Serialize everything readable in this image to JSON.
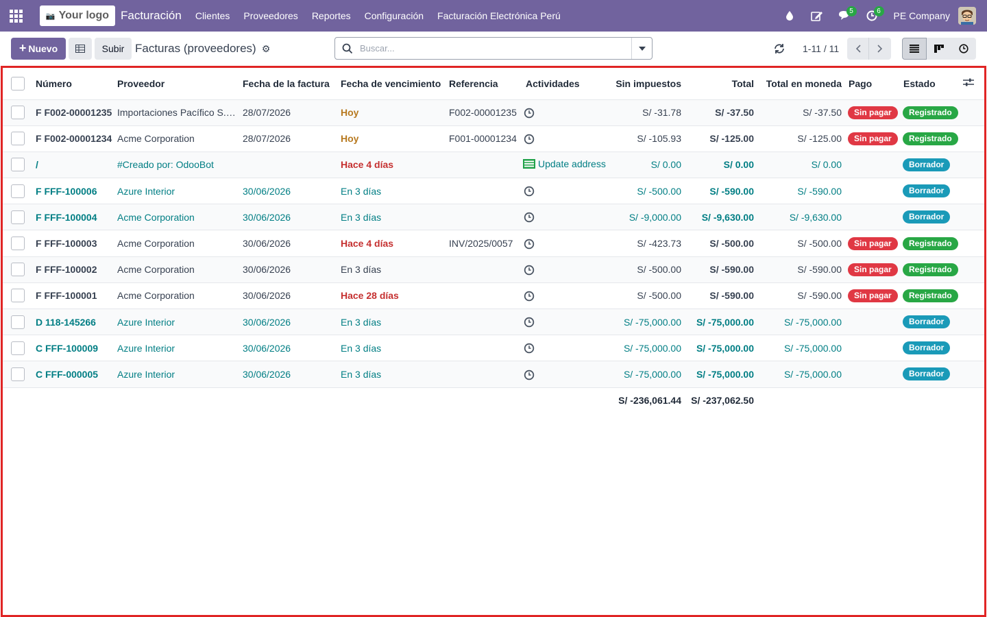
{
  "navbar": {
    "logo_text": "Your logo",
    "app_name": "Facturación",
    "menu": [
      "Clientes",
      "Proveedores",
      "Reportes",
      "Configuración",
      "Facturación Electrónica Perú"
    ],
    "messages_count": "5",
    "activities_count": "6",
    "company": "PE Company"
  },
  "control": {
    "new_label": "Nuevo",
    "upload_label": "Subir",
    "title": "Facturas (proveedores)",
    "search_placeholder": "Buscar...",
    "pager": "1-11 / 11"
  },
  "table": {
    "headers": [
      "Número",
      "Proveedor",
      "Fecha de la factura",
      "Fecha de vencimiento",
      "Referencia",
      "Actividades",
      "Sin impuestos",
      "Total",
      "Total en moneda",
      "Pago",
      "Estado"
    ],
    "rows": [
      {
        "number": "F F002-00001235",
        "partner": "Importaciones Pacífico S.A.C.",
        "date": "28/07/2026",
        "due": "Hoy",
        "due_type": "today",
        "ref": "F002-00001235",
        "activity": "",
        "untaxed": "S/ -31.78",
        "total": "S/ -37.50",
        "total_cur": "S/ -37.50",
        "payment": "Sin pagar",
        "state": "Registrado",
        "link": false
      },
      {
        "number": "F F002-00001234",
        "partner": "Acme Corporation",
        "date": "28/07/2026",
        "due": "Hoy",
        "due_type": "today",
        "ref": "F001-00001234",
        "activity": "",
        "untaxed": "S/ -105.93",
        "total": "S/ -125.00",
        "total_cur": "S/ -125.00",
        "payment": "Sin pagar",
        "state": "Registrado",
        "link": false
      },
      {
        "number": "/",
        "partner": "#Creado por: OdooBot",
        "date": "",
        "due": "Hace 4 días",
        "due_type": "late",
        "ref": "",
        "activity": "Update address",
        "untaxed": "S/ 0.00",
        "total": "S/ 0.00",
        "total_cur": "S/ 0.00",
        "payment": "",
        "state": "Borrador",
        "link": true
      },
      {
        "number": "F FFF-100006",
        "partner": "Azure Interior",
        "date": "30/06/2026",
        "due": "En 3 días",
        "due_type": "future",
        "ref": "",
        "activity": "",
        "untaxed": "S/ -500.00",
        "total": "S/ -590.00",
        "total_cur": "S/ -590.00",
        "payment": "",
        "state": "Borrador",
        "link": true
      },
      {
        "number": "F FFF-100004",
        "partner": "Acme Corporation",
        "date": "30/06/2026",
        "due": "En 3 días",
        "due_type": "future",
        "ref": "",
        "activity": "",
        "untaxed": "S/ -9,000.00",
        "total": "S/ -9,630.00",
        "total_cur": "S/ -9,630.00",
        "payment": "",
        "state": "Borrador",
        "link": true
      },
      {
        "number": "F FFF-100003",
        "partner": "Acme Corporation",
        "date": "30/06/2026",
        "due": "Hace 4 días",
        "due_type": "late",
        "ref": "INV/2025/0057",
        "activity": "",
        "untaxed": "S/ -423.73",
        "total": "S/ -500.00",
        "total_cur": "S/ -500.00",
        "payment": "Sin pagar",
        "state": "Registrado",
        "link": false
      },
      {
        "number": "F FFF-100002",
        "partner": "Acme Corporation",
        "date": "30/06/2026",
        "due": "En 3 días",
        "due_type": "future",
        "ref": "",
        "activity": "",
        "untaxed": "S/ -500.00",
        "total": "S/ -590.00",
        "total_cur": "S/ -590.00",
        "payment": "Sin pagar",
        "state": "Registrado",
        "link": false
      },
      {
        "number": "F FFF-100001",
        "partner": "Acme Corporation",
        "date": "30/06/2026",
        "due": "Hace 28 días",
        "due_type": "late",
        "ref": "",
        "activity": "",
        "untaxed": "S/ -500.00",
        "total": "S/ -590.00",
        "total_cur": "S/ -590.00",
        "payment": "Sin pagar",
        "state": "Registrado",
        "link": false
      },
      {
        "number": "D 118-145266",
        "partner": "Azure Interior",
        "date": "30/06/2026",
        "due": "En 3 días",
        "due_type": "future",
        "ref": "",
        "activity": "",
        "untaxed": "S/ -75,000.00",
        "total": "S/ -75,000.00",
        "total_cur": "S/ -75,000.00",
        "payment": "",
        "state": "Borrador",
        "link": true
      },
      {
        "number": "C FFF-100009",
        "partner": "Azure Interior",
        "date": "30/06/2026",
        "due": "En 3 días",
        "due_type": "future",
        "ref": "",
        "activity": "",
        "untaxed": "S/ -75,000.00",
        "total": "S/ -75,000.00",
        "total_cur": "S/ -75,000.00",
        "payment": "",
        "state": "Borrador",
        "link": true
      },
      {
        "number": "C FFF-000005",
        "partner": "Azure Interior",
        "date": "30/06/2026",
        "due": "En 3 días",
        "due_type": "future",
        "ref": "",
        "activity": "",
        "untaxed": "S/ -75,000.00",
        "total": "S/ -75,000.00",
        "total_cur": "S/ -75,000.00",
        "payment": "",
        "state": "Borrador",
        "link": true
      }
    ],
    "totals": {
      "untaxed": "S/ -236,061.44",
      "total": "S/ -237,062.50"
    }
  },
  "colors": {
    "brand": "#71639e",
    "link": "#017e84",
    "danger": "#e03844",
    "success": "#28a745",
    "info": "#1a9ab8"
  }
}
